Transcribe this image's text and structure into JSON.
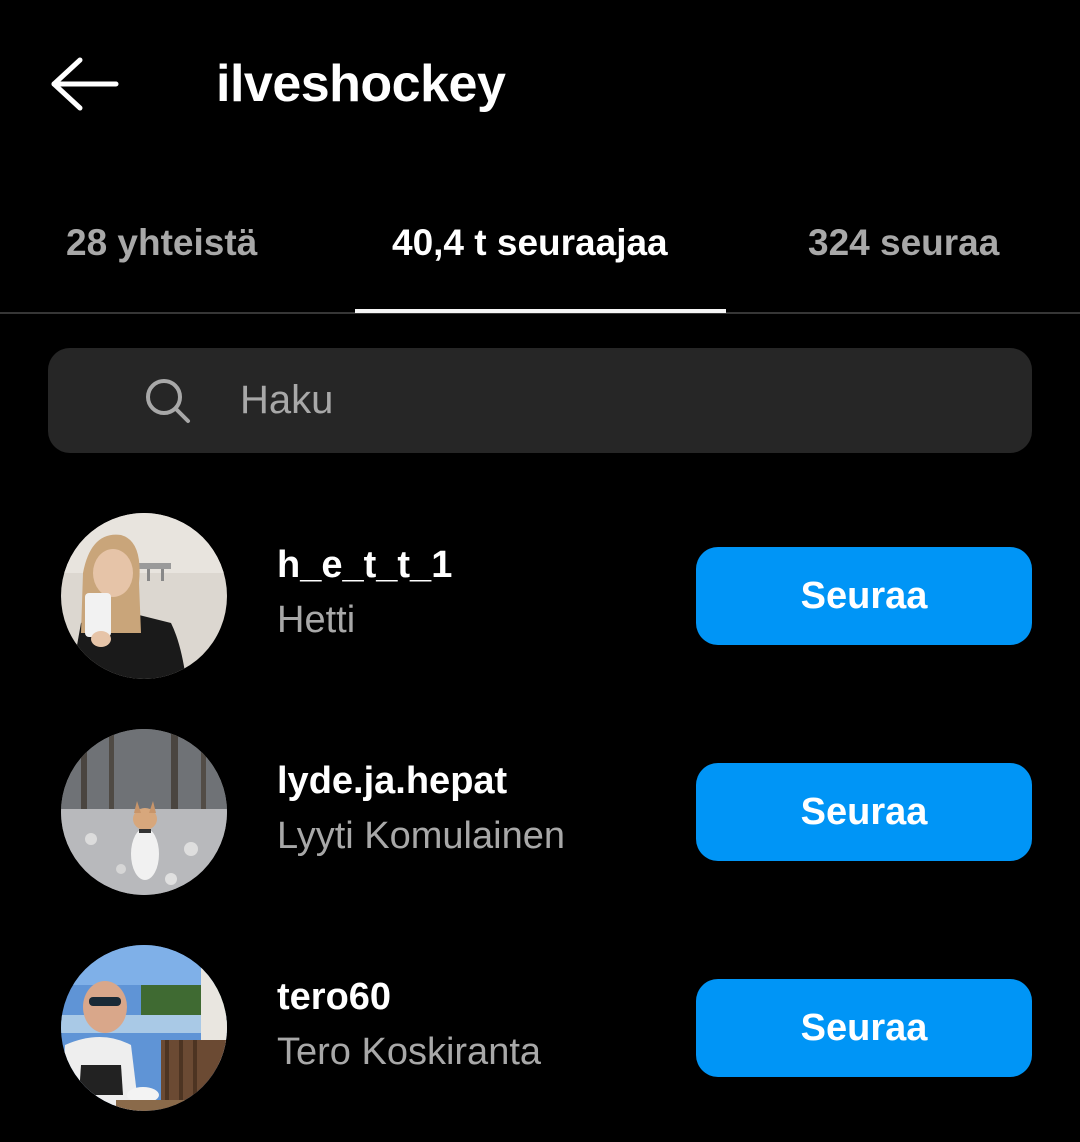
{
  "header": {
    "back_icon": "arrow-left-icon",
    "title": "ilveshockey"
  },
  "tabs": [
    {
      "label": "28 yhteistä",
      "active": false
    },
    {
      "label": "40,4 t seuraajaa",
      "active": true
    },
    {
      "label": "324 seuraa",
      "active": false
    }
  ],
  "search": {
    "icon": "search-icon",
    "placeholder": "Haku",
    "value": ""
  },
  "users": [
    {
      "username": "h_e_t_t_1",
      "full_name": "Hetti",
      "button_label": "Seuraa",
      "avatar": "avatar-photo"
    },
    {
      "username": "lyde.ja.hepat",
      "full_name": "Lyyti Komulainen",
      "button_label": "Seuraa",
      "avatar": "avatar-photo"
    },
    {
      "username": "tero60",
      "full_name": "Tero Koskiranta",
      "button_label": "Seuraa",
      "avatar": "avatar-photo"
    }
  ],
  "colors": {
    "background": "#000000",
    "accent_button": "#0095f6",
    "search_bg": "#262626",
    "secondary_text": "#a8a8a8"
  }
}
